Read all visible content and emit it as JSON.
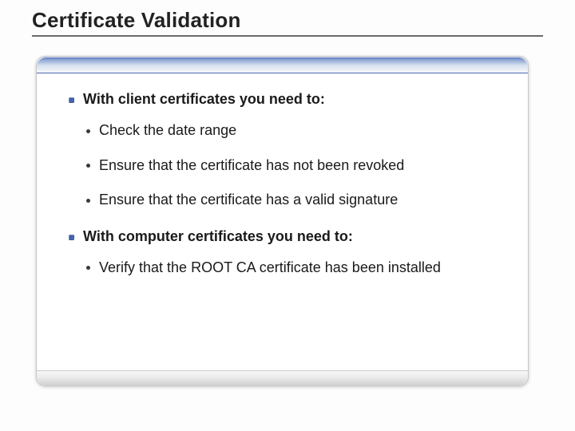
{
  "slide": {
    "title": "Certificate Validation",
    "sections": [
      {
        "heading": "With client certificates you need to:",
        "items": [
          "Check the date range",
          "Ensure that the certificate has not been revoked",
          "Ensure that the certificate has a valid signature"
        ]
      },
      {
        "heading": "With computer certificates you need to:",
        "items": [
          "Verify that the ROOT CA certificate has been installed"
        ]
      }
    ]
  }
}
